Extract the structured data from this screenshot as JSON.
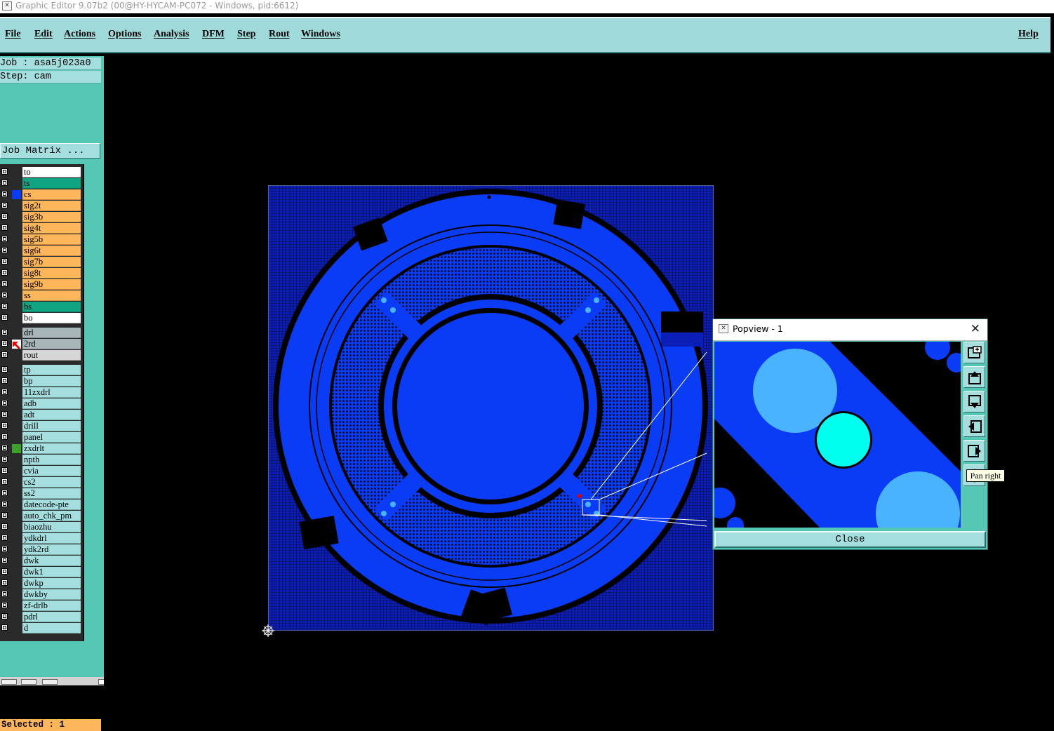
{
  "window": {
    "title": "Graphic Editor 9.07b2 (00@HY-HYCAM-PC072 - Windows, pid:6612)"
  },
  "menu": [
    {
      "label": "File"
    },
    {
      "label": "Edit"
    },
    {
      "label": "Actions"
    },
    {
      "label": "Options"
    },
    {
      "label": "Analysis"
    },
    {
      "label": "DFM"
    },
    {
      "label": "Step"
    },
    {
      "label": "Rout"
    },
    {
      "label": "Windows"
    },
    {
      "label": "Help"
    }
  ],
  "job": {
    "job_line": "Job : asa5j023a0",
    "step_line": "Step: cam",
    "matrix_button": "Job Matrix ..."
  },
  "colors": {
    "board": "#0b3cf5",
    "orange": "#fdb65a",
    "teal": "#10a483",
    "white": "#ffffff",
    "gray": "#a8b6b9",
    "cyan": "#a4dede"
  },
  "layers": [
    {
      "name": "to",
      "color": "#ffffff"
    },
    {
      "name": "ts",
      "color": "#10a483"
    },
    {
      "name": "cs",
      "color": "#fdb65a",
      "swatch": "#0b3cf5"
    },
    {
      "name": "sig2t",
      "color": "#fdb65a"
    },
    {
      "name": "sig3b",
      "color": "#fdb65a"
    },
    {
      "name": "sig4t",
      "color": "#fdb65a"
    },
    {
      "name": "sig5b",
      "color": "#fdb65a"
    },
    {
      "name": "sig6t",
      "color": "#fdb65a"
    },
    {
      "name": "sig7b",
      "color": "#fdb65a"
    },
    {
      "name": "sig8t",
      "color": "#fdb65a"
    },
    {
      "name": "sig9b",
      "color": "#fdb65a"
    },
    {
      "name": "ss",
      "color": "#fdb65a"
    },
    {
      "name": "bs",
      "color": "#10a483"
    },
    {
      "name": "bo",
      "color": "#ffffff"
    },
    {
      "name": "drl",
      "color": "#a8b6b9"
    },
    {
      "name": "2rd",
      "color": "#a8b6b9",
      "active": true
    },
    {
      "name": "rout",
      "color": "#d6d6d6"
    },
    {
      "name": "tp",
      "color": "#a4dede"
    },
    {
      "name": "bp",
      "color": "#a4dede"
    },
    {
      "name": "11zxdrl",
      "color": "#a4dede"
    },
    {
      "name": "adb",
      "color": "#a4dede"
    },
    {
      "name": "adt",
      "color": "#a4dede"
    },
    {
      "name": "drill",
      "color": "#a4dede"
    },
    {
      "name": "panel",
      "color": "#a4dede"
    },
    {
      "name": "zxdrlt",
      "color": "#a4dede",
      "swatch": "#3ca027"
    },
    {
      "name": "npth",
      "color": "#a4dede"
    },
    {
      "name": "cvia",
      "color": "#a4dede"
    },
    {
      "name": "cs2",
      "color": "#a4dede"
    },
    {
      "name": "ss2",
      "color": "#a4dede"
    },
    {
      "name": "datecode-pte",
      "color": "#a4dede"
    },
    {
      "name": "auto_chk_pm",
      "color": "#a4dede"
    },
    {
      "name": "biaozhu",
      "color": "#a4dede"
    },
    {
      "name": "ydkdrl",
      "color": "#a4dede"
    },
    {
      "name": "ydk2rd",
      "color": "#a4dede"
    },
    {
      "name": "dwk",
      "color": "#a4dede"
    },
    {
      "name": "dwk1",
      "color": "#a4dede"
    },
    {
      "name": "dwkp",
      "color": "#a4dede"
    },
    {
      "name": "dwkby",
      "color": "#a4dede"
    },
    {
      "name": "zf-drlb",
      "color": "#a4dede"
    },
    {
      "name": "pdrl",
      "color": "#a4dede"
    },
    {
      "name": "d",
      "color": "#a4dede"
    }
  ],
  "status": {
    "selected": "Selected : 1"
  },
  "popview": {
    "title": "Popview - 1",
    "close_label": "Close",
    "tool_buttons": [
      "zoom-in-icon",
      "pan-up-icon",
      "pan-down-icon",
      "pan-left-icon",
      "pan-right-icon",
      "pan-center-icon"
    ],
    "tooltip": "Pan right"
  }
}
